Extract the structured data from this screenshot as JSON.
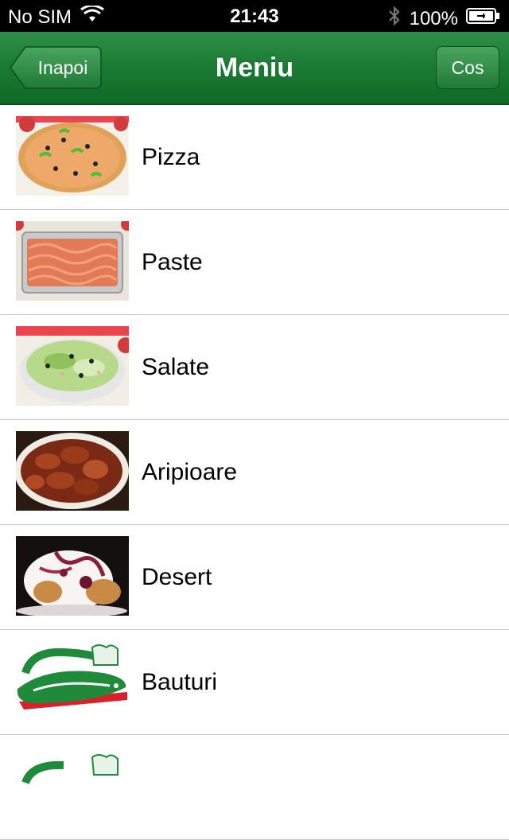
{
  "status_bar": {
    "carrier": "No SIM",
    "time": "21:43",
    "battery": "100%"
  },
  "nav": {
    "back_label": "Inapoi",
    "title": "Meniu",
    "right_label": "Cos"
  },
  "menu_items": [
    {
      "label": "Pizza",
      "thumb": "pizza-photo"
    },
    {
      "label": "Paste",
      "thumb": "pasta-photo"
    },
    {
      "label": "Salate",
      "thumb": "salad-photo"
    },
    {
      "label": "Aripioare",
      "thumb": "wings-photo"
    },
    {
      "label": "Desert",
      "thumb": "dessert-photo"
    },
    {
      "label": "Bauturi",
      "thumb": "presto-pizza-logo"
    }
  ],
  "colors": {
    "nav_green": "#1a7a33",
    "status_bar": "#000000"
  }
}
